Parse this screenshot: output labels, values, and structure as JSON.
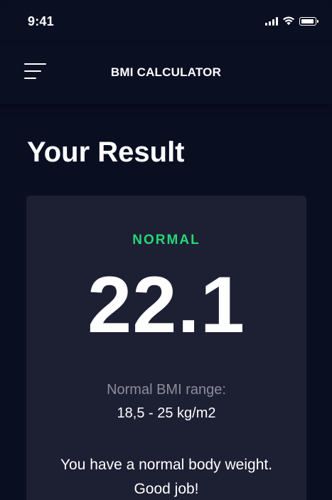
{
  "status_bar": {
    "time": "9:41",
    "icons": [
      "cellular-signal-icon",
      "wifi-icon",
      "battery-icon"
    ]
  },
  "app_bar": {
    "menu_icon": "menu-icon",
    "title": "BMI CALCULATOR"
  },
  "page": {
    "title": "Your Result"
  },
  "result": {
    "status": "NORMAL",
    "bmi": "22.1",
    "range_label": "Normal BMI range:",
    "range_value": "18,5 - 25 kg/m2",
    "message": "You have a normal body weight. Good job!"
  },
  "colors": {
    "background": "#0a0e21",
    "card": "#1d1f33",
    "status_green": "#24d876",
    "muted_text": "#8d8e98",
    "text": "#ffffff"
  }
}
